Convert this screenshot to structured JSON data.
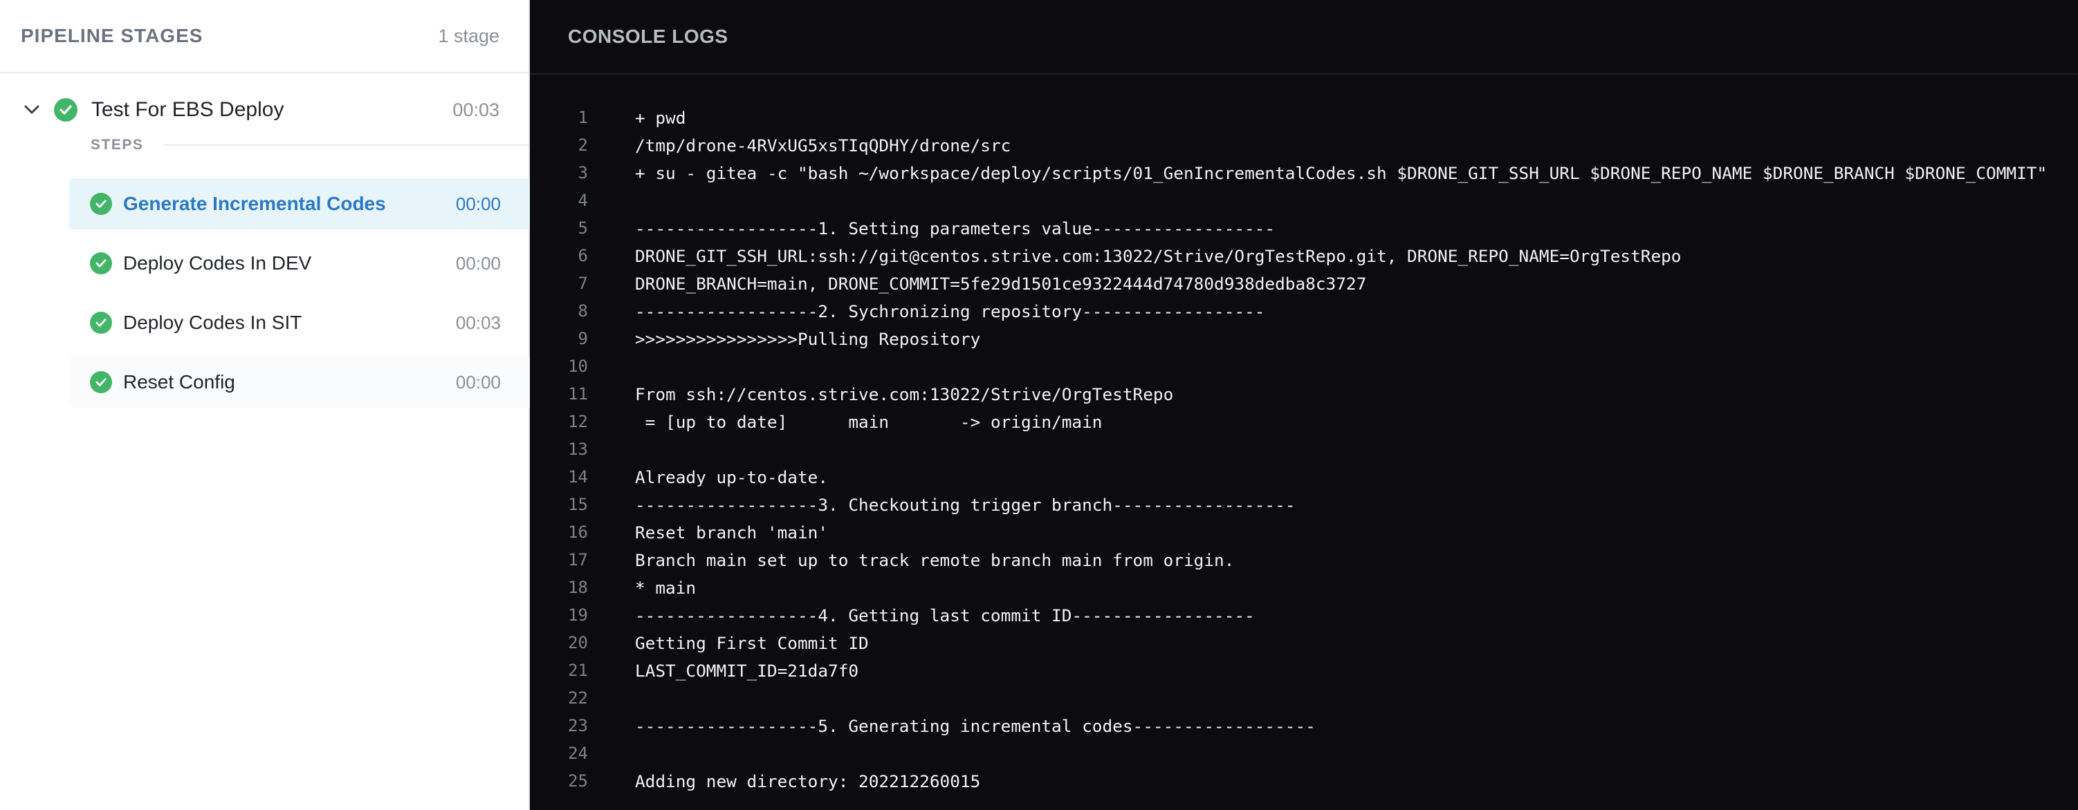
{
  "left_panel": {
    "title": "PIPELINE STAGES",
    "count": "1 stage",
    "stage": {
      "name": "Test For EBS Deploy",
      "time": "00:03",
      "status": "success"
    },
    "steps_label": "STEPS",
    "steps": [
      {
        "name": "Generate Incremental Codes",
        "time": "00:00",
        "status": "success",
        "active": true
      },
      {
        "name": "Deploy Codes In DEV",
        "time": "00:00",
        "status": "success",
        "active": false
      },
      {
        "name": "Deploy Codes In SIT",
        "time": "00:03",
        "status": "success",
        "active": false
      },
      {
        "name": "Reset Config",
        "time": "00:00",
        "status": "success",
        "active": false
      }
    ]
  },
  "console": {
    "title": "CONSOLE LOGS",
    "lines": [
      {
        "n": "1",
        "text": "+ pwd"
      },
      {
        "n": "2",
        "text": "/tmp/drone-4RVxUG5xsTIqQDHY/drone/src"
      },
      {
        "n": "3",
        "text": "+ su - gitea -c \"bash ~/workspace/deploy/scripts/01_GenIncrementalCodes.sh $DRONE_GIT_SSH_URL $DRONE_REPO_NAME $DRONE_BRANCH $DRONE_COMMIT\""
      },
      {
        "n": "4",
        "text": ""
      },
      {
        "n": "5",
        "text": "------------------1. Setting parameters value------------------"
      },
      {
        "n": "6",
        "text": "DRONE_GIT_SSH_URL:ssh://git@centos.strive.com:13022/Strive/OrgTestRepo.git, DRONE_REPO_NAME=OrgTestRepo"
      },
      {
        "n": "7",
        "text": "DRONE_BRANCH=main, DRONE_COMMIT=5fe29d1501ce9322444d74780d938dedba8c3727"
      },
      {
        "n": "8",
        "text": "------------------2. Sychronizing repository------------------"
      },
      {
        "n": "9",
        "text": ">>>>>>>>>>>>>>>>Pulling Repository"
      },
      {
        "n": "10",
        "text": ""
      },
      {
        "n": "11",
        "text": "From ssh://centos.strive.com:13022/Strive/OrgTestRepo"
      },
      {
        "n": "12",
        "text": " = [up to date]      main       -> origin/main"
      },
      {
        "n": "13",
        "text": ""
      },
      {
        "n": "14",
        "text": "Already up-to-date."
      },
      {
        "n": "15",
        "text": "------------------3. Checkouting trigger branch------------------"
      },
      {
        "n": "16",
        "text": "Reset branch 'main'"
      },
      {
        "n": "17",
        "text": "Branch main set up to track remote branch main from origin."
      },
      {
        "n": "18",
        "text": "* main"
      },
      {
        "n": "19",
        "text": "------------------4. Getting last commit ID------------------"
      },
      {
        "n": "20",
        "text": "Getting First Commit ID"
      },
      {
        "n": "21",
        "text": "LAST_COMMIT_ID=21da7f0"
      },
      {
        "n": "22",
        "text": ""
      },
      {
        "n": "23",
        "text": "------------------5. Generating incremental codes------------------"
      },
      {
        "n": "24",
        "text": ""
      },
      {
        "n": "25",
        "text": "Adding new directory: 202212260015"
      }
    ]
  },
  "colors": {
    "success": "#42b568",
    "active_text": "#2b78c5",
    "active_bg": "#e7f5fb",
    "console_bg": "#0c0c0e"
  },
  "icons": {
    "stage_toggle": "chevron-down-icon",
    "status": "check-circle-icon"
  }
}
